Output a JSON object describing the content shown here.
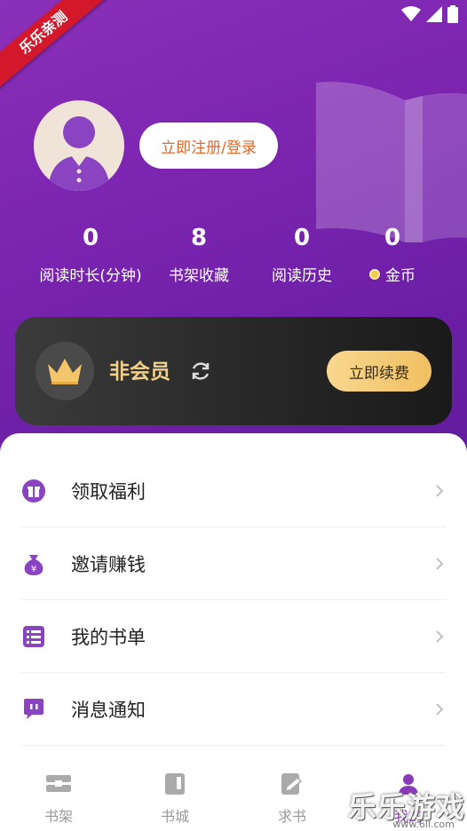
{
  "ribbon": {
    "text": "乐乐亲测"
  },
  "profile": {
    "login_label": "立即注册/登录"
  },
  "stats": [
    {
      "value": "0",
      "label": "阅读时长(分钟)"
    },
    {
      "value": "8",
      "label": "书架收藏"
    },
    {
      "value": "0",
      "label": "阅读历史"
    },
    {
      "value": "0",
      "label": "金币"
    }
  ],
  "vip": {
    "status_label": "非会员",
    "renew_label": "立即续费"
  },
  "menu": [
    {
      "label": "领取福利",
      "icon": "gift-icon"
    },
    {
      "label": "邀请赚钱",
      "icon": "money-bag-icon"
    },
    {
      "label": "我的书单",
      "icon": "list-icon"
    },
    {
      "label": "消息通知",
      "icon": "message-icon"
    }
  ],
  "nav": [
    {
      "label": "书架",
      "icon": "bookshelf-icon"
    },
    {
      "label": "书城",
      "icon": "bookstore-icon"
    },
    {
      "label": "求书",
      "icon": "request-book-icon"
    },
    {
      "label": "我的",
      "icon": "profile-icon",
      "active": true
    }
  ],
  "watermark": {
    "text": "乐乐游戏",
    "url": "www.6ll.com"
  },
  "colors": {
    "header_purple": "#7a24b0",
    "accent_orange": "#e1682a",
    "vip_gold": "#f3d08a",
    "menu_icon_purple": "#8a44c2"
  }
}
